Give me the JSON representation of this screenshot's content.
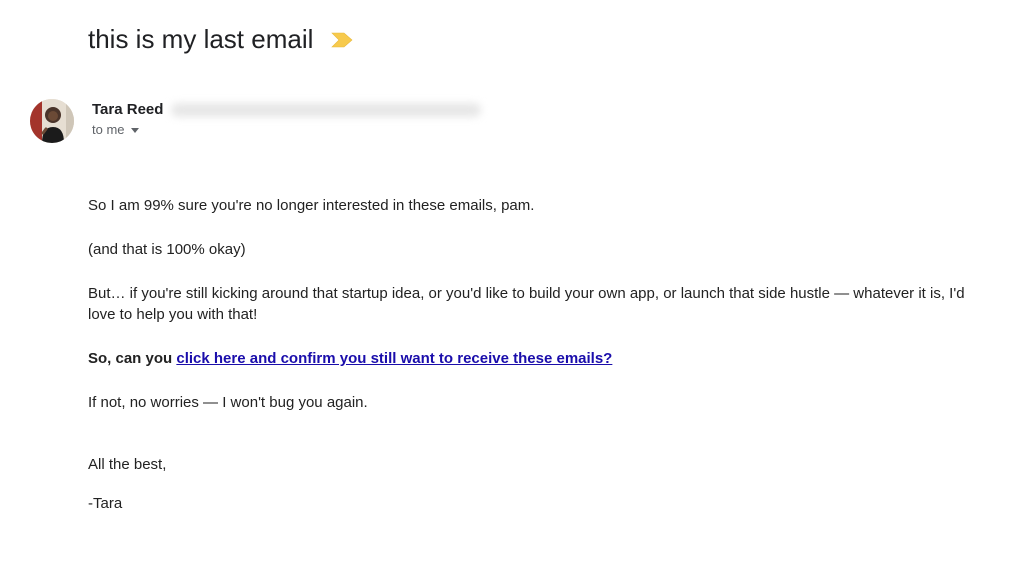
{
  "subject": "this is my last email",
  "label": {
    "name": "important",
    "fill": "#f7ca4d",
    "stroke": "#e8b93a"
  },
  "sender": {
    "name": "Tara Reed"
  },
  "recipient_line": "to me",
  "body": {
    "p1": "So I am 99% sure you're no longer interested in these emails, pam.",
    "p2": "(and that is 100% okay)",
    "p3": "But… if you're still kicking around that startup idea, or you'd like to build your own app, or launch that side hustle — whatever it is, I'd love to help you with that!",
    "cta_prefix": "So, can you ",
    "cta_link": "click here and confirm you still want to receive these emails?",
    "p5": "If not, no worries — I won't bug you again.",
    "signoff1": "All the best,",
    "signoff2": "-Tara"
  }
}
